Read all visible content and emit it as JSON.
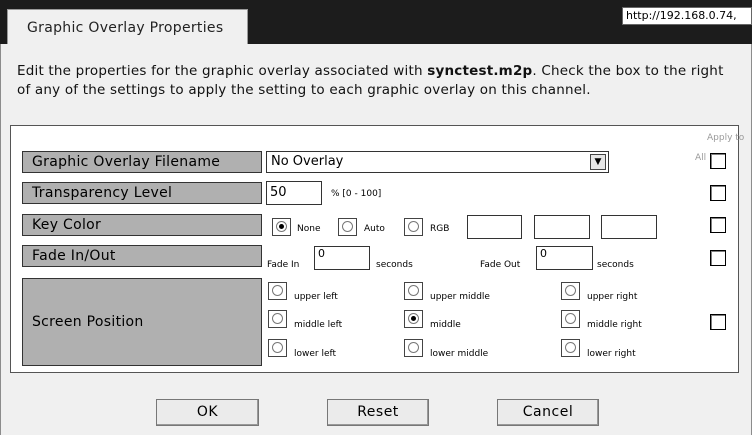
{
  "tab": {
    "title": "Graphic Overlay Properties"
  },
  "browser": {
    "url": "http://192.168.0.74,"
  },
  "intro": {
    "text_before": "Edit the properties for the graphic overlay associated with ",
    "filename": "synctest.m2p",
    "text_after": ". Check the box to the right of any of the settings to apply the setting to each graphic overlay on this channel."
  },
  "apply_to_all": {
    "line1": "Apply to",
    "line2": "All"
  },
  "rows": {
    "filename": {
      "label": "Graphic Overlay Filename",
      "value": "No Overlay"
    },
    "transparency": {
      "label": "Transparency Level",
      "value": "50",
      "hint": "% [0 - 100]"
    },
    "key_color": {
      "label": "Key Color",
      "none": "None",
      "auto": "Auto",
      "rgb": "RGB",
      "selected": "None"
    },
    "fade": {
      "label": "Fade In/Out",
      "fade_in_label": "Fade In",
      "fade_in_value": "0",
      "fade_in_unit": "seconds",
      "fade_out_label": "Fade Out",
      "fade_out_value": "0",
      "fade_out_unit": "seconds"
    },
    "position": {
      "label": "Screen Position",
      "selected": "middle",
      "options": [
        "upper left",
        "upper middle",
        "upper right",
        "middle left",
        "middle",
        "middle right",
        "lower left",
        "lower middle",
        "lower right"
      ]
    }
  },
  "buttons": {
    "ok": "OK",
    "reset": "Reset",
    "cancel": "Cancel"
  }
}
